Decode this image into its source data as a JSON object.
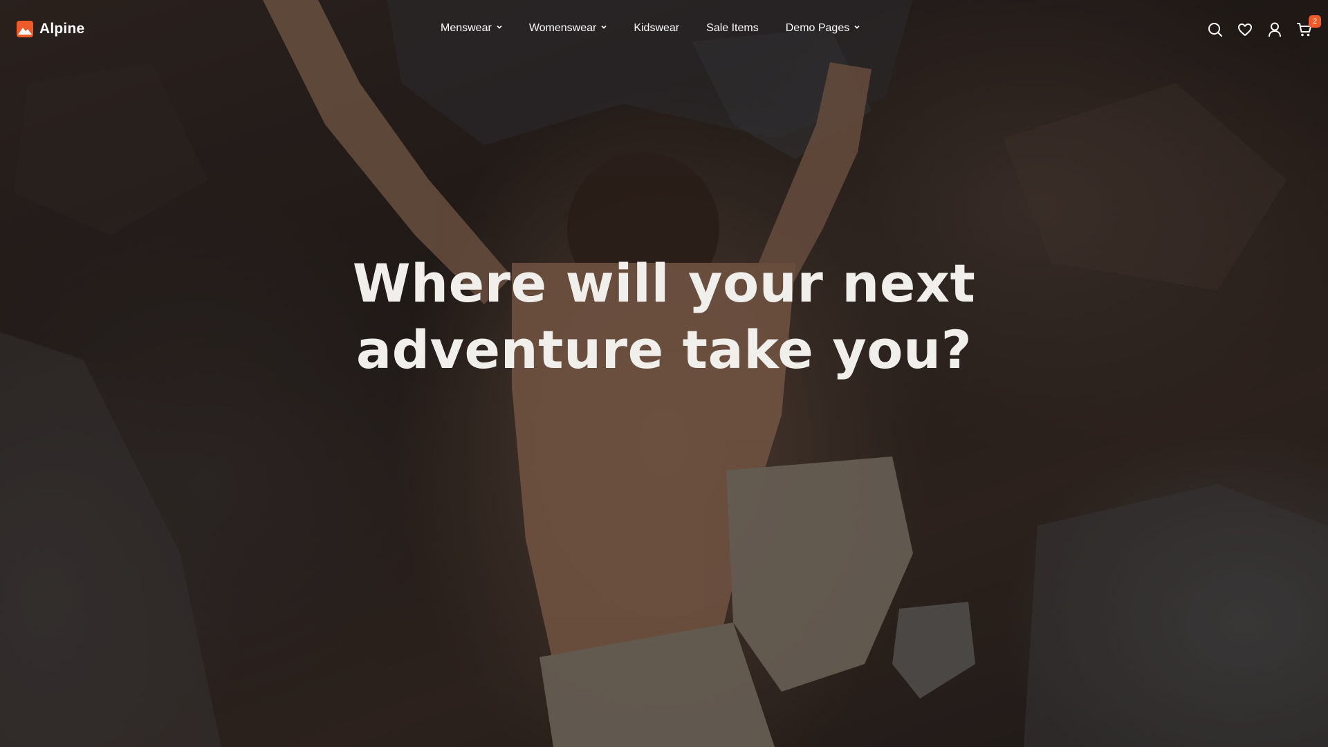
{
  "brand": {
    "name": "Alpine",
    "logo_icon": "mountain-logo-icon",
    "accent_color": "#ef5a2a"
  },
  "nav": {
    "items": [
      {
        "label": "Menswear",
        "has_dropdown": true
      },
      {
        "label": "Womenswear",
        "has_dropdown": true
      },
      {
        "label": "Kidswear",
        "has_dropdown": false
      },
      {
        "label": "Sale Items",
        "has_dropdown": false
      },
      {
        "label": "Demo Pages",
        "has_dropdown": true
      }
    ]
  },
  "header_icons": {
    "search": "search-icon",
    "wishlist": "heart-icon",
    "account": "user-icon",
    "cart": "cart-icon",
    "cart_count": "2"
  },
  "hero": {
    "headline_line1": "Where will your next",
    "headline_line2": "adventure take you?"
  }
}
